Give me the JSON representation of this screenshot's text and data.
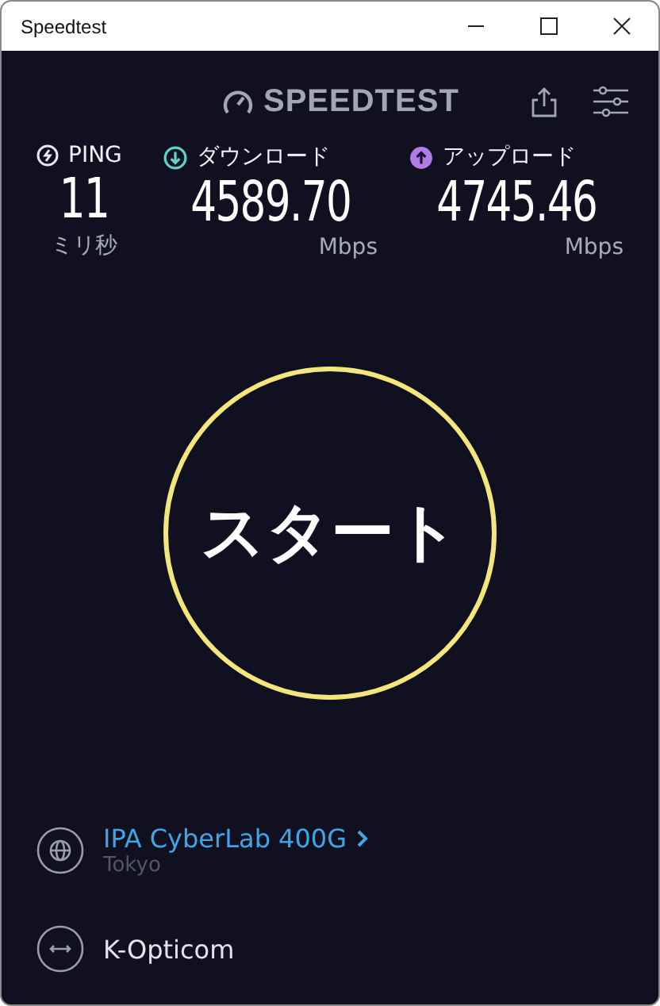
{
  "window": {
    "title": "Speedtest"
  },
  "logo": {
    "text": "SPEEDTEST"
  },
  "metrics": [
    {
      "kind": "ping",
      "label": "PING",
      "value": "11",
      "unit": "ミリ秒"
    },
    {
      "kind": "download",
      "label": "ダウンロード",
      "value": "4589.70",
      "unit": "Mbps"
    },
    {
      "kind": "upload",
      "label": "アップロード",
      "value": "4745.46",
      "unit": "Mbps"
    }
  ],
  "start_button": {
    "label": "スタート"
  },
  "server": {
    "name": "IPA CyberLab 400G",
    "location": "Tokyo"
  },
  "provider": {
    "name": "K-Opticom"
  }
}
